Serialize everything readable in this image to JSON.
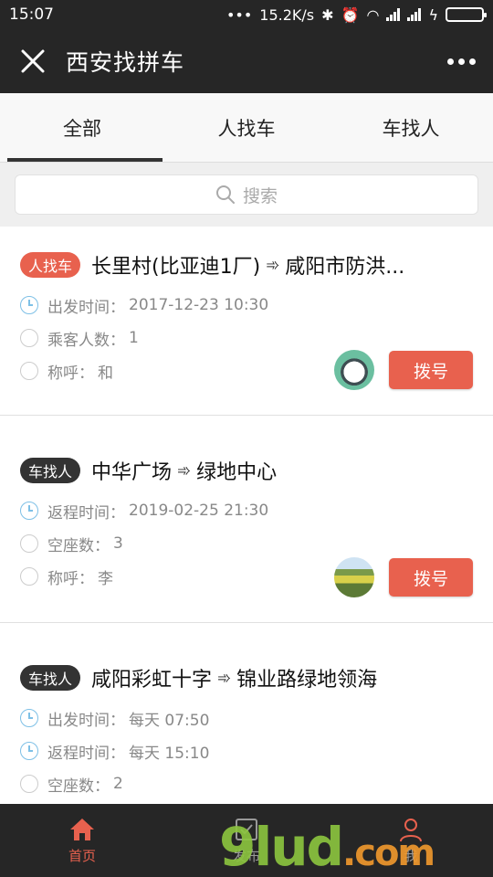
{
  "status": {
    "time": "15:07",
    "network_speed": "15.2K/s",
    "battery_color": "#5fd33d"
  },
  "nav": {
    "title": "西安找拼车"
  },
  "tabs": [
    {
      "label": "全部",
      "active": true
    },
    {
      "label": "人找车",
      "active": false
    },
    {
      "label": "车找人",
      "active": false
    }
  ],
  "search": {
    "placeholder": "搜索"
  },
  "listings": [
    {
      "tag": "人找车",
      "tag_color": "#e8614e",
      "from": "长里村(比亚迪1厂)",
      "to": "咸阳市防洪...",
      "rows": [
        {
          "label": "出发时间：",
          "value": "2017-12-23 10:30",
          "icon": "clock-icon"
        },
        {
          "label": "乘客人数：",
          "value": "1",
          "icon": "circle-icon"
        },
        {
          "label": "称呼：",
          "value": "和",
          "icon": "circle-icon"
        }
      ],
      "avatar": "cat-avatar",
      "button": "拨号"
    },
    {
      "tag": "车找人",
      "tag_color": "#333333",
      "from": "中华广场",
      "to": "绿地中心",
      "rows": [
        {
          "label": "返程时间：",
          "value": "2019-02-25 21:30",
          "icon": "clock-icon"
        },
        {
          "label": "空座数：",
          "value": "3",
          "icon": "circle-icon"
        },
        {
          "label": "称呼：",
          "value": "李",
          "icon": "circle-icon"
        }
      ],
      "avatar": "field-avatar",
      "button": "拨号"
    },
    {
      "tag": "车找人",
      "tag_color": "#333333",
      "from": "咸阳彩虹十字",
      "to": "锦业路绿地领海",
      "rows": [
        {
          "label": "出发时间：",
          "value": "每天 07:50",
          "icon": "clock-icon"
        },
        {
          "label": "返程时间：",
          "value": "每天 15:10",
          "icon": "clock-icon"
        },
        {
          "label": "空座数：",
          "value": "2",
          "icon": "circle-icon"
        }
      ]
    }
  ],
  "bottom_nav": [
    {
      "label": "首页",
      "icon": "home-icon",
      "active": true
    },
    {
      "label": "发布",
      "icon": "publish-icon",
      "active": false
    },
    {
      "label": "我",
      "icon": "user-icon",
      "active": false
    }
  ],
  "watermark": {
    "main": "9lud",
    "suffix": ".com"
  },
  "accent_color": "#e8614e"
}
